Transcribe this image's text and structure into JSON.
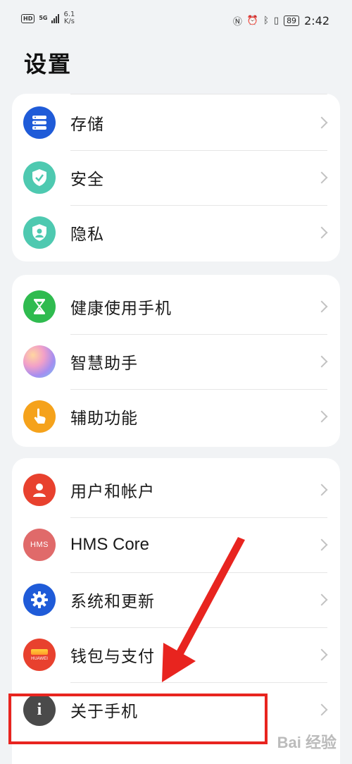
{
  "status_bar": {
    "hd": "HD",
    "network": "5G",
    "speed_value": "6.1",
    "speed_unit": "K/s",
    "battery": "89",
    "time": "2:42",
    "icons": [
      "nfc-icon",
      "alarm-icon",
      "bluetooth-icon",
      "vibrate-icon",
      "battery-icon"
    ]
  },
  "page_title": "设置",
  "groups": [
    {
      "items": [
        {
          "label": "存储",
          "icon": "storage-icon",
          "color": "#1f5bd8"
        },
        {
          "label": "安全",
          "icon": "security-shield-icon",
          "color": "#4ec9b0"
        },
        {
          "label": "隐私",
          "icon": "privacy-shield-icon",
          "color": "#4ec9b0"
        }
      ]
    },
    {
      "items": [
        {
          "label": "健康使用手机",
          "icon": "hourglass-icon",
          "color": "#2fbb4f"
        },
        {
          "label": "智慧助手",
          "icon": "assistant-orb-icon",
          "color": "#c98ad8"
        },
        {
          "label": "辅助功能",
          "icon": "hand-pointer-icon",
          "color": "#f5a21b"
        }
      ]
    },
    {
      "items": [
        {
          "label": "用户和帐户",
          "icon": "user-icon",
          "color": "#e8412e"
        },
        {
          "label": "HMS Core",
          "icon": "hms-icon",
          "icon_text": "HMS",
          "color": "#e06a6a"
        },
        {
          "label": "系统和更新",
          "icon": "gear-icon",
          "color": "#1f5bd8"
        },
        {
          "label": "钱包与支付",
          "icon": "wallet-icon",
          "icon_text": "HUAWEI",
          "color": "#e8412e"
        },
        {
          "label": "关于手机",
          "icon": "info-icon",
          "color": "#4a4a4a"
        }
      ]
    }
  ],
  "annotation": {
    "color": "#e8241f"
  },
  "watermark": "Bai 经验"
}
